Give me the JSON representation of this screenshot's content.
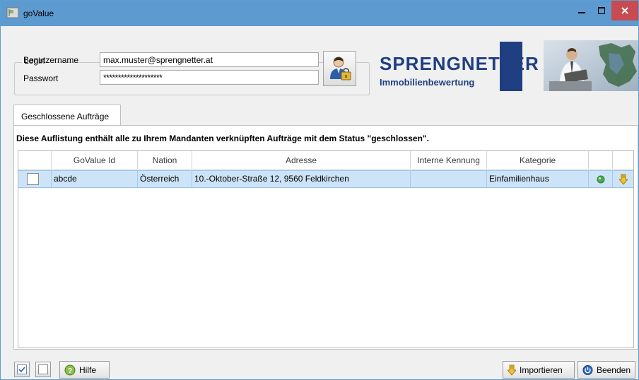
{
  "window": {
    "title": "goValue",
    "icon": "flag-icon",
    "controls": {
      "minimize_icon": "minimize-icon",
      "maximize_icon": "maximize-icon",
      "close_icon": "close-icon",
      "close_color": "#c74b50"
    },
    "titlebar_color": "#5d9ad0"
  },
  "login": {
    "legend": "Login",
    "username_label": "Benutzername",
    "username_value": "max.muster@sprengnetter.at",
    "password_label": "Passwort",
    "password_value": "********************",
    "login_button_icon": "user-lock-icon"
  },
  "branding": {
    "logo_text": "SPRENGNETTER",
    "logo_subtext": "Immobilienbewertung",
    "brand_color": "#1f3f82"
  },
  "tabs": [
    {
      "label": "Geschlossene Aufträge",
      "active": true
    }
  ],
  "description": "Diese Auflistung enthält alle zu Ihrem Mandanten verknüpften Aufträge mit dem Status \"geschlossen\".",
  "table": {
    "columns": [
      "",
      "GoValue Id",
      "Nation",
      "Adresse",
      "Interne Kennung",
      "Kategorie",
      "",
      ""
    ],
    "rows": [
      {
        "checked": false,
        "id": "abcde",
        "nation": "Österreich",
        "address": "10.-Oktober-Straße 12, 9560 Feldkirchen",
        "internal_id": "",
        "category": "Einfamilienhaus",
        "status_icon": "green-status-dot-icon",
        "import_icon": "download-arrow-icon"
      }
    ],
    "selected_row_color": "#cde3f7"
  },
  "footer": {
    "check_all_icon": "check-all-icon",
    "uncheck_all_icon": "uncheck-all-icon",
    "help_label": "Hilfe",
    "import_label": "Importieren",
    "exit_label": "Beenden"
  }
}
